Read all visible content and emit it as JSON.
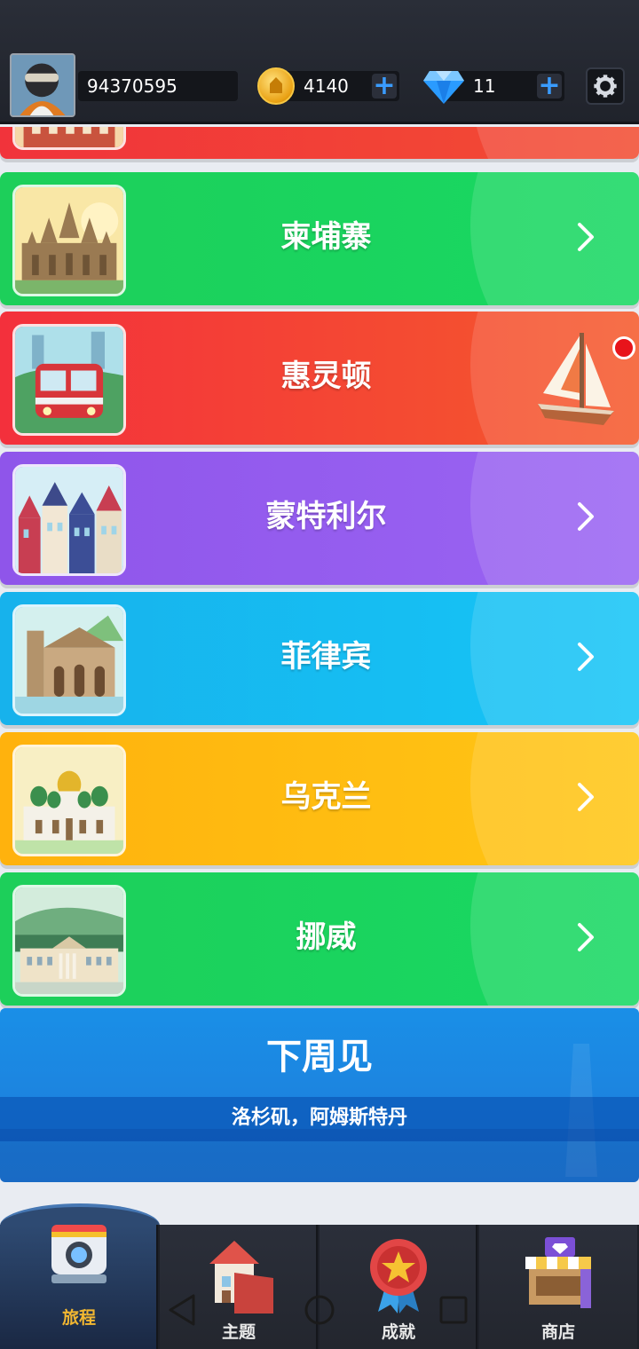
{
  "header": {
    "user_id": "94370595",
    "coins": "4140",
    "gems": "11",
    "add_coins_label": "+",
    "add_gems_label": "+"
  },
  "destinations": [
    {
      "name": "",
      "color": "#f1333b"
    },
    {
      "name": "柬埔寨",
      "color": "#1dcf5a",
      "icon": "angkor-wat-icon"
    },
    {
      "name": "惠灵顿",
      "color": "#f3303c",
      "icon": "train-icon",
      "badge": "sailboat-icon",
      "notification": true
    },
    {
      "name": "蒙特利尔",
      "color": "#8f55ea",
      "icon": "montreal-houses-icon"
    },
    {
      "name": "菲律宾",
      "color": "#17b2ec",
      "icon": "church-icon"
    },
    {
      "name": "乌克兰",
      "color": "#ffb20d",
      "icon": "cathedral-icon"
    },
    {
      "name": "挪威",
      "color": "#1dcf5a",
      "icon": "palace-icon"
    }
  ],
  "next_week": {
    "title": "下周见",
    "subtitle": "洛杉矶，阿姆斯特丹"
  },
  "bottom_nav": [
    {
      "label": "旅程",
      "icon": "camera-icon",
      "active": true
    },
    {
      "label": "主题",
      "icon": "house-icon",
      "active": false
    },
    {
      "label": "成就",
      "icon": "star-medal-icon",
      "active": false
    },
    {
      "label": "商店",
      "icon": "shop-icon",
      "active": false
    }
  ]
}
